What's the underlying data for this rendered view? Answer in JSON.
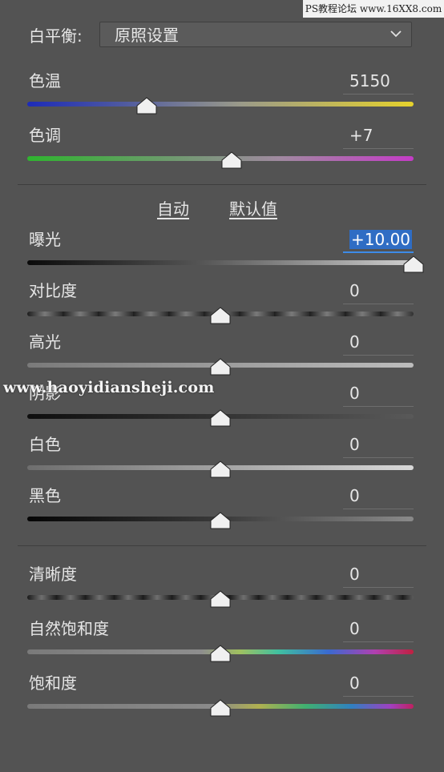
{
  "watermarks": {
    "top": "PS教程论坛 www.16XX8.com",
    "middle": "www.haoyidiansheji.com"
  },
  "white_balance": {
    "label": "白平衡:",
    "selected": "原照设置",
    "icon": "chevron-down-icon"
  },
  "buttons": {
    "auto": "自动",
    "default": "默认值"
  },
  "sliders": {
    "temp": {
      "label": "色温",
      "value": "5150",
      "level": 0.31,
      "accent": "#e6d22c"
    },
    "tint": {
      "label": "色调",
      "value": "+7",
      "level": 0.53,
      "accent": "#c43cc6"
    },
    "exposure": {
      "label": "曝光",
      "value": "+10.00",
      "level": 1.0,
      "accent": "#3d8be8"
    },
    "contrast": {
      "label": "对比度",
      "value": "0",
      "level": 0.5
    },
    "highlights": {
      "label": "高光",
      "value": "0",
      "level": 0.5
    },
    "shadows": {
      "label": "阴影",
      "value": "0",
      "level": 0.5
    },
    "whites": {
      "label": "白色",
      "value": "0",
      "level": 0.5
    },
    "blacks": {
      "label": "黑色",
      "value": "0",
      "level": 0.5
    },
    "clarity": {
      "label": "清晰度",
      "value": "0",
      "level": 0.5
    },
    "vibrance": {
      "label": "自然饱和度",
      "value": "0",
      "level": 0.5
    },
    "saturation": {
      "label": "饱和度",
      "value": "0",
      "level": 0.5
    }
  }
}
